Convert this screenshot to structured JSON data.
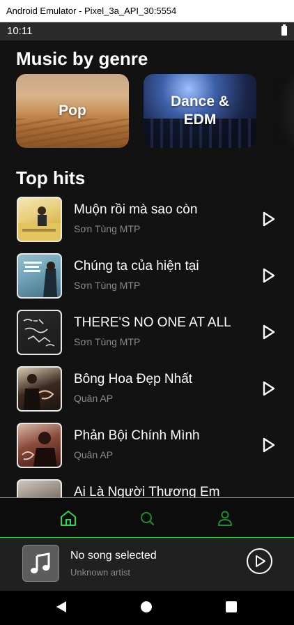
{
  "window": {
    "title": "Android Emulator - Pixel_3a_API_30:5554"
  },
  "status_bar": {
    "time": "10:11"
  },
  "genres_section": {
    "title": "Music by genre",
    "genres": [
      {
        "label": "Pop"
      },
      {
        "label": "Dance & EDM"
      },
      {
        "label": ""
      }
    ]
  },
  "top_hits": {
    "title": "Top hits",
    "tracks": [
      {
        "title": "Muộn rồi mà sao còn",
        "artist": "Sơn Tùng MTP"
      },
      {
        "title": "Chúng ta của hiện tại",
        "artist": "Sơn Tùng MTP"
      },
      {
        "title": "THERE'S NO ONE AT ALL",
        "artist": "Sơn Tùng MTP"
      },
      {
        "title": "Bông Hoa Đẹp Nhất",
        "artist": "Quân AP"
      },
      {
        "title": "Phản Bội Chính Mình",
        "artist": "Quân AP"
      },
      {
        "title": "Ai Là Người Thương Em",
        "artist": ""
      }
    ]
  },
  "bottom_nav": {
    "items": [
      {
        "icon": "home-icon",
        "active": true
      },
      {
        "icon": "search-icon",
        "active": false
      },
      {
        "icon": "profile-icon",
        "active": false
      }
    ],
    "accent_color": "#2ed84a"
  },
  "mini_player": {
    "title": "No song selected",
    "artist": "Unknown artist",
    "art_icon": "music-note-icon",
    "play_icon": "play-circle-icon"
  },
  "android_nav": {
    "buttons": [
      "back-icon",
      "home-circle-icon",
      "recents-icon"
    ]
  }
}
